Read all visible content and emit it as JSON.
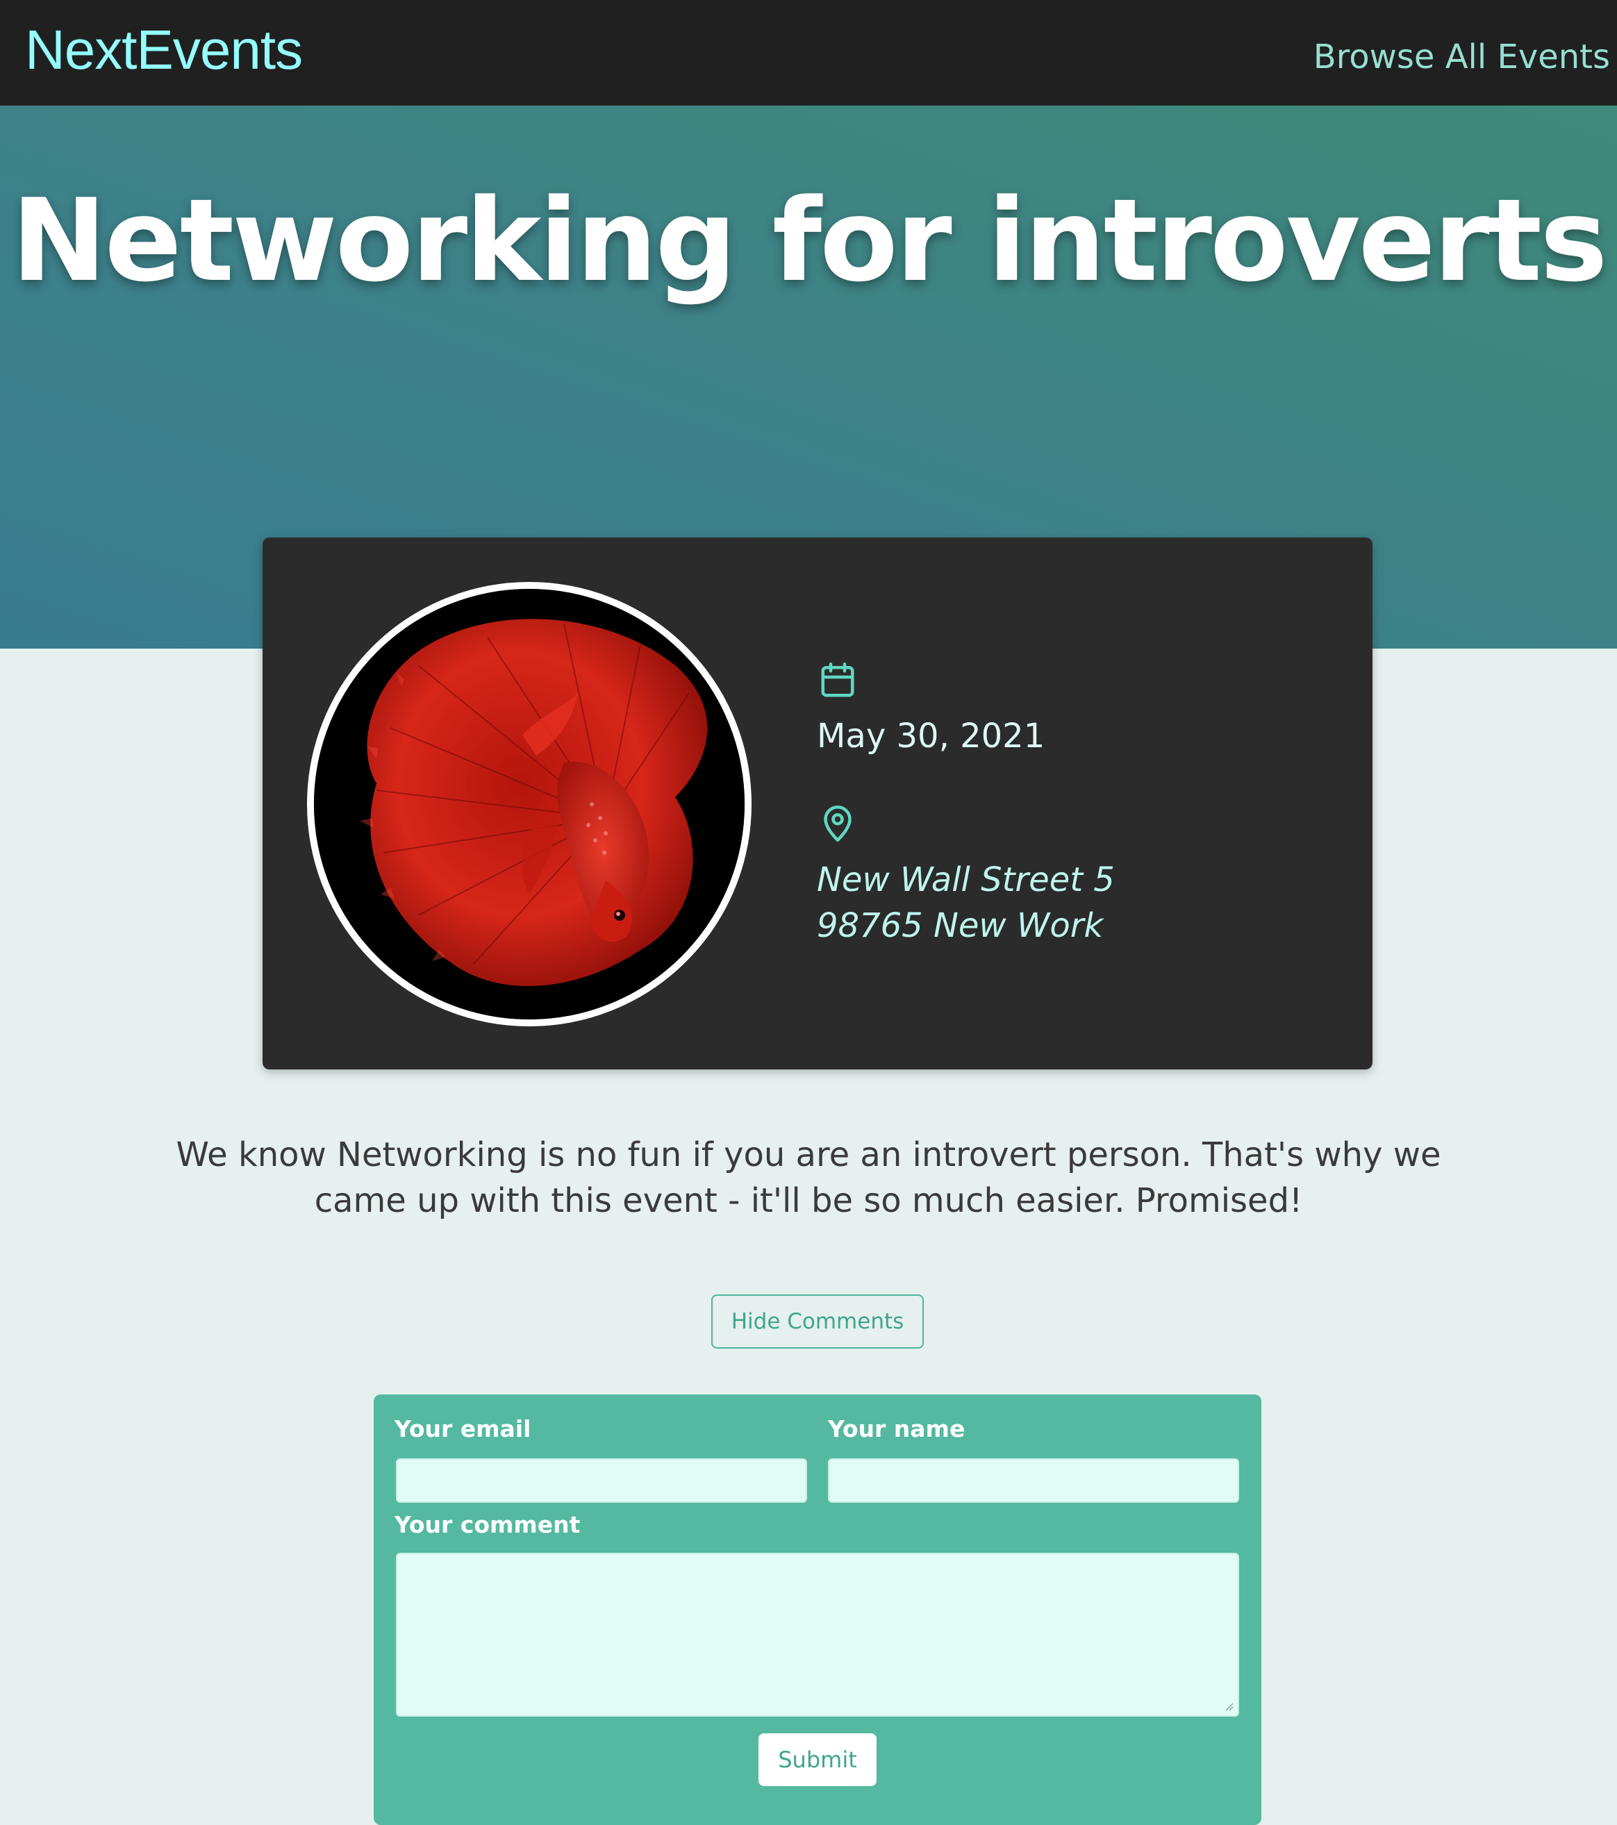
{
  "header": {
    "logo": "NextEvents",
    "nav_link": "Browse All Events"
  },
  "event": {
    "title": "Networking for introverts",
    "date": "May 30, 2021",
    "address_line1": "New Wall Street 5",
    "address_line2": "98765 New Work",
    "description": "We know Networking is no fun if you are an introvert person. That's why we came up with this event - it'll be so much easier. Promised!",
    "image": "red-betta-fish"
  },
  "comments": {
    "toggle_label": "Hide Comments",
    "email_label": "Your email",
    "name_label": "Your name",
    "comment_label": "Your comment",
    "email_value": "",
    "name_value": "",
    "comment_value": "",
    "submit_label": "Submit"
  },
  "icons": {
    "date": "calendar-icon",
    "location": "map-pin-icon"
  },
  "colors": {
    "header_bg": "#202020",
    "logo": "#94fdfd",
    "nav_link": "#96dfd0",
    "hero_gradient_start": "#3f8a78",
    "hero_gradient_end": "#3a7c8f",
    "card_bg": "#2b2b2b",
    "accent": "#54b9a0",
    "page_bg": "#e6f0ef",
    "input_bg": "#e1fcf6"
  }
}
